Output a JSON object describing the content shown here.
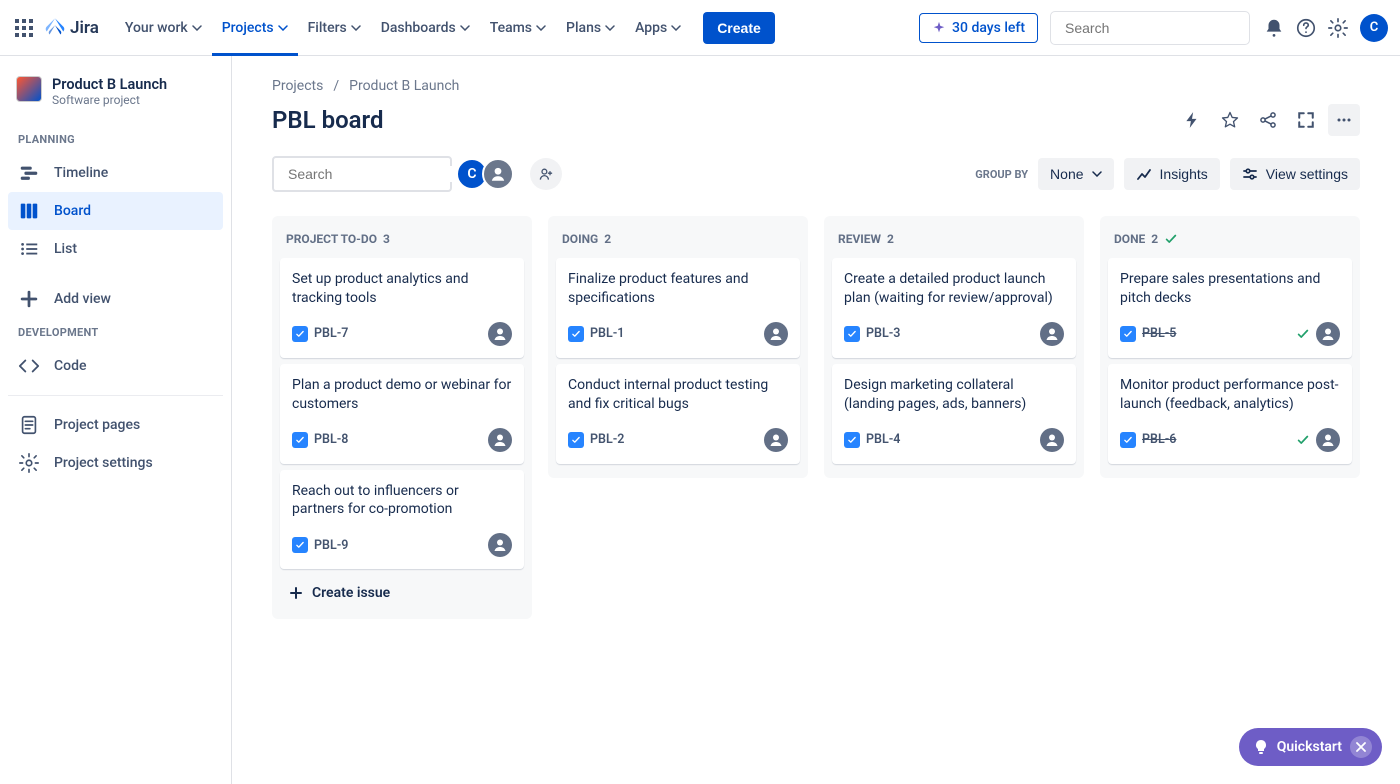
{
  "topnav": {
    "logo_text": "Jira",
    "items": [
      {
        "label": "Your work"
      },
      {
        "label": "Projects",
        "active": true
      },
      {
        "label": "Filters"
      },
      {
        "label": "Dashboards"
      },
      {
        "label": "Teams"
      },
      {
        "label": "Plans"
      },
      {
        "label": "Apps"
      }
    ],
    "create_label": "Create",
    "days_left_label": "30 days left",
    "search_placeholder": "Search",
    "avatar_initial": "C"
  },
  "sidebar": {
    "project_name": "Product B Launch",
    "project_subtitle": "Software project",
    "planning_label": "PLANNING",
    "development_label": "DEVELOPMENT",
    "items": {
      "timeline": "Timeline",
      "board": "Board",
      "list": "List",
      "add_view": "Add view",
      "code": "Code",
      "project_pages": "Project pages",
      "project_settings": "Project settings"
    }
  },
  "breadcrumb": {
    "projects": "Projects",
    "current": "Product B Launch"
  },
  "page_title": "PBL board",
  "toolbar": {
    "search_placeholder": "Search",
    "group_by_label": "GROUP BY",
    "group_by_value": "None",
    "insights_label": "Insights",
    "view_settings_label": "View settings",
    "avatar_initial": "C"
  },
  "columns": [
    {
      "name": "PROJECT TO-DO",
      "count": "3",
      "done": false,
      "show_create": true,
      "create_label": "Create issue",
      "cards": [
        {
          "title": "Set up product analytics and tracking tools",
          "key": "PBL-7",
          "done": false
        },
        {
          "title": "Plan a product demo or webinar for customers",
          "key": "PBL-8",
          "done": false
        },
        {
          "title": "Reach out to influencers or partners for co-promotion",
          "key": "PBL-9",
          "done": false
        }
      ]
    },
    {
      "name": "DOING",
      "count": "2",
      "done": false,
      "show_create": false,
      "cards": [
        {
          "title": "Finalize product features and specifications",
          "key": "PBL-1",
          "done": false
        },
        {
          "title": "Conduct internal product testing and fix critical bugs",
          "key": "PBL-2",
          "done": false
        }
      ]
    },
    {
      "name": "REVIEW",
      "count": "2",
      "done": false,
      "show_create": false,
      "cards": [
        {
          "title": "Create a detailed product launch plan (waiting for review/approval)",
          "key": "PBL-3",
          "done": false
        },
        {
          "title": "Design marketing collateral (landing pages, ads, banners)",
          "key": "PBL-4",
          "done": false
        }
      ]
    },
    {
      "name": "DONE",
      "count": "2",
      "done": true,
      "show_create": false,
      "cards": [
        {
          "title": "Prepare sales presentations and pitch decks",
          "key": "PBL-5",
          "done": true
        },
        {
          "title": "Monitor product performance post-launch (feedback, analytics)",
          "key": "PBL-6",
          "done": true
        }
      ]
    }
  ],
  "quickstart_label": "Quickstart"
}
